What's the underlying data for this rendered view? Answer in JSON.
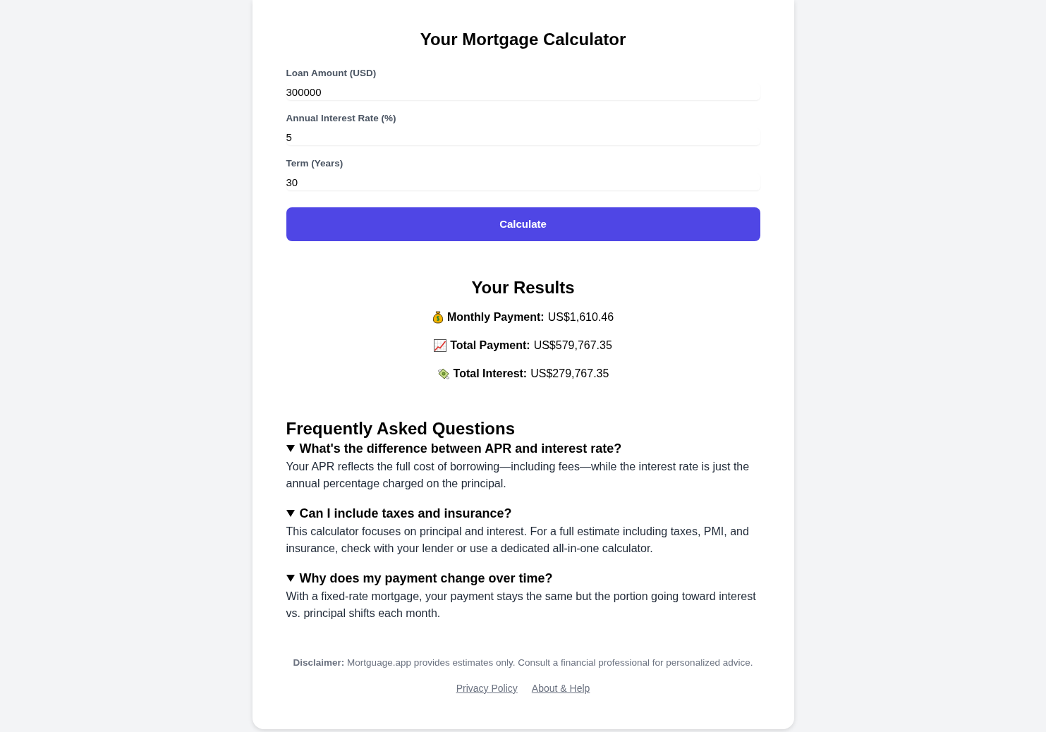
{
  "calculator": {
    "title": "Your Mortgage Calculator",
    "fields": [
      {
        "label": "Loan Amount (USD)",
        "value": "300000"
      },
      {
        "label": "Annual Interest Rate (%)",
        "value": "5"
      },
      {
        "label": "Term (Years)",
        "value": "30"
      }
    ],
    "button": "Calculate"
  },
  "results": {
    "title": "Your Results",
    "items": [
      {
        "kind": "bag",
        "label": "Monthly Payment:",
        "value": "US$1,610.46"
      },
      {
        "kind": "chart",
        "label": "Total Payment:",
        "value": "US$579,767.35"
      },
      {
        "kind": "banknote",
        "label": "Total Interest:",
        "value": "US$279,767.35"
      }
    ]
  },
  "faq": {
    "title": "Frequently Asked Questions",
    "items": [
      {
        "question": "What's the difference between APR and interest rate?",
        "answer": "Your APR reflects the full cost of borrowing—including fees—while the interest rate is just the annual percentage charged on the principal.",
        "expanded": true
      },
      {
        "question": "Can I include taxes and insurance?",
        "answer": "This calculator focuses on principal and interest. For a full estimate including taxes, PMI, and insurance, check with your lender or use a dedicated all-in-one calculator.",
        "expanded": true
      },
      {
        "question": "Why does my payment change over time?",
        "answer": "With a fixed-rate mortgage, your payment stays the same but the portion going toward interest vs. principal shifts each month.",
        "expanded": true
      }
    ]
  },
  "footer": {
    "disclaimer": "**Disclaimer:** Mortguage.app provides estimates only. Consult a financial professional for personalized advice.",
    "links": [
      "Privacy Policy",
      "About & Help"
    ]
  }
}
